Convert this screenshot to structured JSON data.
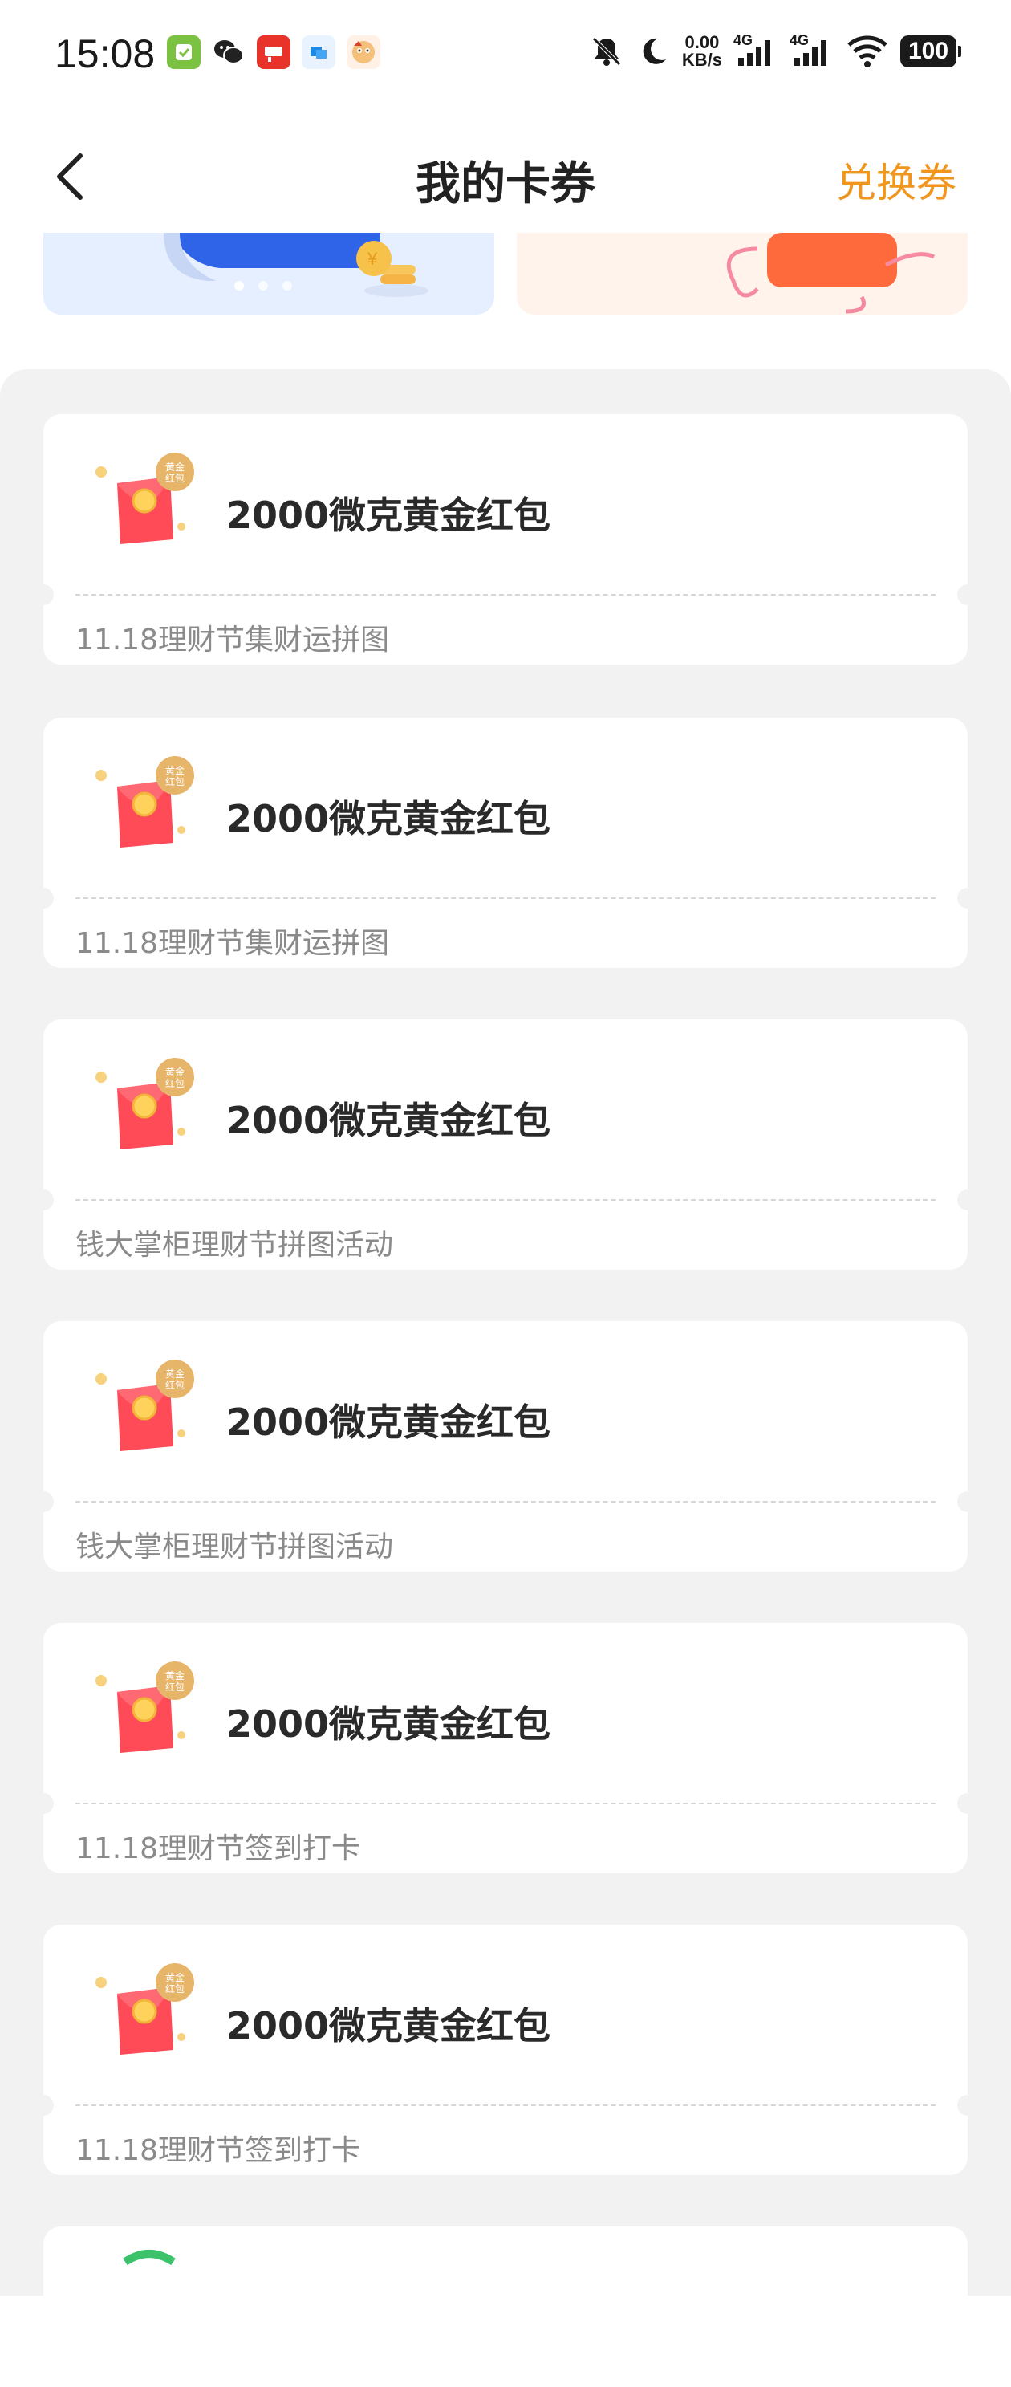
{
  "status_bar": {
    "time": "15:08",
    "net_speed_value": "0.00",
    "net_speed_unit": "KB/s",
    "signal_1_label": "4G",
    "signal_2_label": "4G",
    "battery": "100",
    "app_icons": [
      "wechat-pay-icon",
      "wechat-icon",
      "app-store-icon",
      "message-app-icon",
      "game-app-icon"
    ]
  },
  "nav": {
    "title": "我的卡券",
    "action": "兑换券"
  },
  "banner": {
    "dots": 3,
    "active_dot": 0
  },
  "coupons": [
    {
      "badge": "黄金红包",
      "title": "2000微克黄金红包",
      "source": "11.18理财节集财运拼图"
    },
    {
      "badge": "黄金红包",
      "title": "2000微克黄金红包",
      "source": "11.18理财节集财运拼图"
    },
    {
      "badge": "黄金红包",
      "title": "2000微克黄金红包",
      "source": "钱大掌柜理财节拼图活动"
    },
    {
      "badge": "黄金红包",
      "title": "2000微克黄金红包",
      "source": "钱大掌柜理财节拼图活动"
    },
    {
      "badge": "黄金红包",
      "title": "2000微克黄金红包",
      "source": "11.18理财节签到打卡"
    },
    {
      "badge": "黄金红包",
      "title": "2000微克黄金红包",
      "source": "11.18理财节签到打卡"
    }
  ],
  "colors": {
    "accent": "#f0961e",
    "page_bg": "#f2f2f2",
    "card_bg": "#ffffff"
  }
}
